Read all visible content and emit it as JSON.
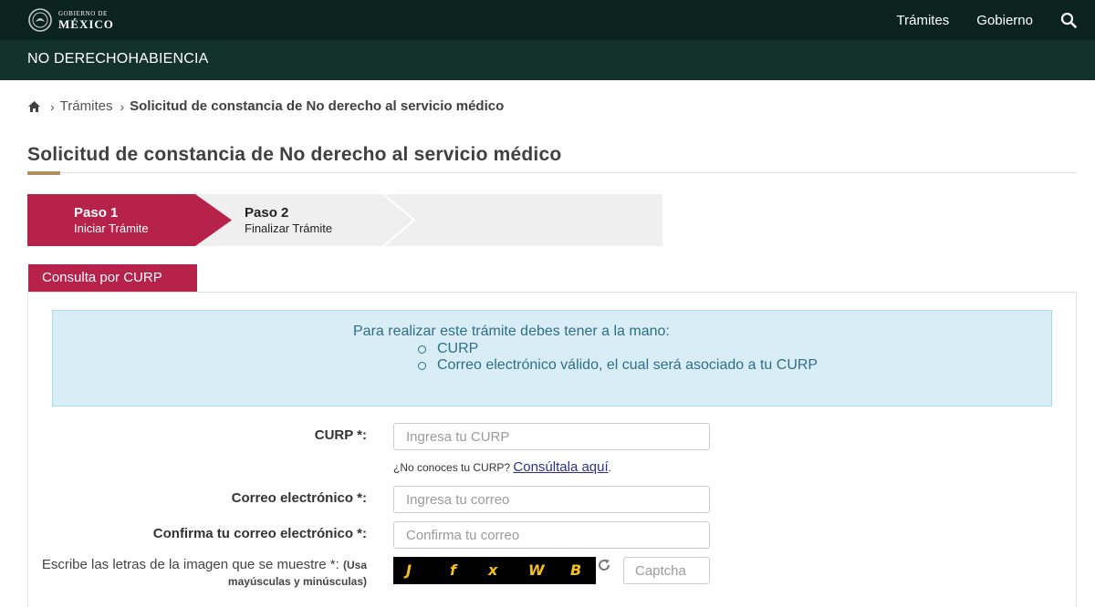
{
  "header": {
    "logo_line1": "GOBIERNO DE",
    "logo_line2": "MÉXICO",
    "nav": [
      "Trámites",
      "Gobierno"
    ],
    "search_icon": "search-icon",
    "brand_color": "#0b231e"
  },
  "subheader": {
    "title": "NO DERECHOHABIENCIA",
    "color": "#13322b"
  },
  "breadcrumb": {
    "home_icon": "home-icon",
    "items": [
      "Trámites",
      "Solicitud de constancia de No derecho al servicio médico"
    ]
  },
  "page": {
    "title": "Solicitud de constancia de No derecho al servicio médico"
  },
  "steps": [
    {
      "num": "Paso 1",
      "label": "Iniciar Trámite",
      "active": true
    },
    {
      "num": "Paso 2",
      "label": "Finalizar Trámite",
      "active": false
    }
  ],
  "tabs": [
    {
      "label": "Consulta por CURP",
      "active": true
    }
  ],
  "info": {
    "heading": "Para realizar este trámite debes tener a la mano:",
    "items": [
      "CURP",
      "Correo electrónico válido, el cual será asociado a tu CURP"
    ]
  },
  "form": {
    "curp_label": "CURP *:",
    "curp_placeholder": "Ingresa tu CURP",
    "curp_help": "¿No conoces tu CURP?",
    "curp_help_link": "Consúltala aquí",
    "curp_help_suffix": ".",
    "email_label": "Correo electrónico *:",
    "email_placeholder": "Ingresa tu correo",
    "confirm_label": "Confirma tu correo electrónico *:",
    "confirm_placeholder": "Confirma tu correo",
    "captcha_label": "Escribe las letras de la imagen que se muestre *:",
    "captcha_note": "(Usa mayúsculas y minúsculas)",
    "captcha_letters": [
      "J",
      "f",
      "x",
      "W",
      "B"
    ],
    "captcha_placeholder": "Captcha"
  },
  "colors": {
    "accent": "#b7224a",
    "gold": "#b38e5d",
    "info_bg": "#d9edf7",
    "info_text": "#2e6f88"
  }
}
